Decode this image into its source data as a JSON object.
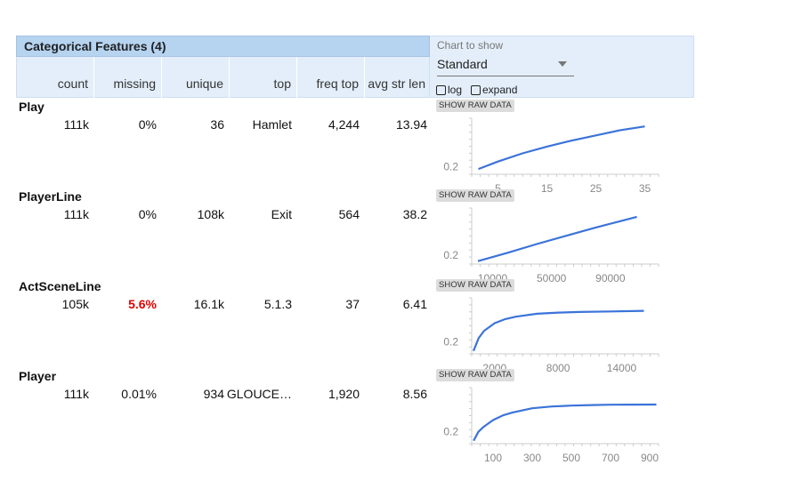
{
  "panel": {
    "title": "Categorical Features (4)",
    "columns": [
      "count",
      "missing",
      "unique",
      "top",
      "freq top",
      "avg str len"
    ],
    "chart_to_show_label": "Chart to show",
    "chart_select_value": "Standard",
    "checkboxes": [
      {
        "label": "log",
        "checked": false
      },
      {
        "label": "expand",
        "checked": false
      }
    ],
    "raw_button_label": "SHOW RAW DATA"
  },
  "features": [
    {
      "name": "Play",
      "count": "111k",
      "missing": "0%",
      "missing_warn": false,
      "unique": "36",
      "top": "Hamlet",
      "freq_top": "4,244",
      "avg_str_len": "13.94"
    },
    {
      "name": "PlayerLine",
      "count": "111k",
      "missing": "0%",
      "missing_warn": false,
      "unique": "108k",
      "top": "Exit",
      "freq_top": "564",
      "avg_str_len": "38.2"
    },
    {
      "name": "ActSceneLine",
      "count": "105k",
      "missing": "5.6%",
      "missing_warn": true,
      "unique": "16.1k",
      "top": "5.1.3",
      "freq_top": "37",
      "avg_str_len": "6.41"
    },
    {
      "name": "Player",
      "count": "111k",
      "missing": "0.01%",
      "missing_warn": false,
      "unique": "934",
      "top": "GLOUCE…",
      "freq_top": "1,920",
      "avg_str_len": "8.56"
    }
  ],
  "line_color": "#3b73d9",
  "chart_data": [
    {
      "type": "line",
      "feature": "Play",
      "x": [
        1,
        5,
        10,
        15,
        20,
        25,
        30,
        35
      ],
      "y": [
        0.17,
        0.27,
        0.38,
        0.47,
        0.55,
        0.62,
        0.69,
        0.74
      ],
      "xlim": [
        0,
        40
      ],
      "ylim": [
        0.1,
        0.85
      ],
      "xticks": [
        "5",
        "15",
        "25",
        "35"
      ],
      "xtick_values": [
        5,
        15,
        25,
        35
      ],
      "yticks": [
        "0.2"
      ],
      "ytick_values": [
        0.2
      ]
    },
    {
      "type": "line",
      "feature": "PlayerLine",
      "x": [
        1,
        20000,
        40000,
        60000,
        80000,
        108000
      ],
      "y": [
        0.1,
        0.24,
        0.39,
        0.53,
        0.67,
        0.85
      ],
      "xlim": [
        -3000,
        130000
      ],
      "ylim": [
        0.05,
        1.0
      ],
      "xticks": [
        "10000",
        "50000",
        "90000"
      ],
      "xtick_values": [
        10000,
        50000,
        90000
      ],
      "yticks": [
        "0.2"
      ],
      "ytick_values": [
        0.2
      ]
    },
    {
      "type": "line",
      "feature": "ActSceneLine",
      "x": [
        1,
        500,
        1000,
        2000,
        3000,
        4000,
        6000,
        8000,
        10000,
        13000,
        16100
      ],
      "y": [
        0.05,
        0.27,
        0.39,
        0.52,
        0.59,
        0.63,
        0.68,
        0.7,
        0.71,
        0.72,
        0.73
      ],
      "xlim": [
        0,
        18500
      ],
      "ylim": [
        0.0,
        0.95
      ],
      "xticks": [
        "2000",
        "8000",
        "14000"
      ],
      "xtick_values": [
        2000,
        8000,
        14000
      ],
      "yticks": [
        "0.2"
      ],
      "ytick_values": [
        0.2
      ]
    },
    {
      "type": "line",
      "feature": "Player",
      "x": [
        1,
        25,
        50,
        100,
        150,
        200,
        300,
        400,
        500,
        600,
        700,
        800,
        934
      ],
      "y": [
        0.05,
        0.2,
        0.28,
        0.4,
        0.48,
        0.53,
        0.6,
        0.63,
        0.645,
        0.655,
        0.66,
        0.662,
        0.663
      ],
      "xlim": [
        0,
        1000
      ],
      "ylim": [
        0.0,
        0.95
      ],
      "xticks": [
        "100",
        "300",
        "500",
        "700",
        "900"
      ],
      "xtick_values": [
        100,
        300,
        500,
        700,
        900
      ],
      "yticks": [
        "0.2"
      ],
      "ytick_values": [
        0.2
      ]
    }
  ]
}
